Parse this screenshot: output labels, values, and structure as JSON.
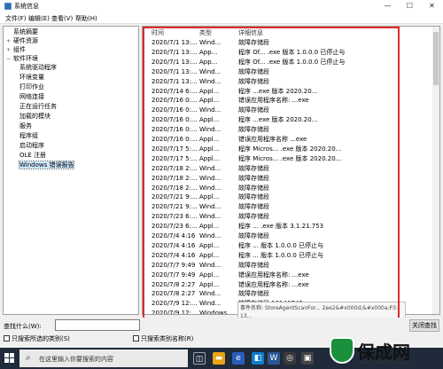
{
  "window": {
    "title": "系统信息",
    "buttons": [
      "—",
      "☐",
      "✕"
    ]
  },
  "menu": [
    "文件(F)",
    "编辑(E)",
    "查看(V)",
    "帮助(H)"
  ],
  "tree": [
    {
      "label": "系统摘要",
      "expander": ""
    },
    {
      "label": "硬件资源",
      "expander": "+"
    },
    {
      "label": "组件",
      "expander": "+"
    },
    {
      "label": "软件环境",
      "expander": "−"
    },
    {
      "label": "系统驱动程序",
      "expander": ""
    },
    {
      "label": "环境变量",
      "expander": ""
    },
    {
      "label": "打印作业",
      "expander": ""
    },
    {
      "label": "网络连接",
      "expander": ""
    },
    {
      "label": "正在运行任务",
      "expander": ""
    },
    {
      "label": "加载的模块",
      "expander": ""
    },
    {
      "label": "服务",
      "expander": ""
    },
    {
      "label": "程序组",
      "expander": ""
    },
    {
      "label": "启动程序",
      "expander": ""
    },
    {
      "label": "OLE 注册",
      "expander": ""
    },
    {
      "label": "Windows 错误报告",
      "expander": ""
    }
  ],
  "list": {
    "headers": [
      "时间",
      "类型",
      "详细信息"
    ],
    "rows": [
      {
        "time": "2020/7/1 13:...",
        "type": "Wind...",
        "detail": "故障存储段"
      },
      {
        "time": "2020/7/1 13:...",
        "type": "App...",
        "detail": "程序 Of... .exe 版本 1.0.0.0 已停止与"
      },
      {
        "time": "2020/7/1 13:...",
        "type": "App...",
        "detail": "程序 Of... .exe 版本 1.0.0.0 已停止与"
      },
      {
        "time": "2020/7/1 13:...",
        "type": "Wind...",
        "detail": "故障存储段"
      },
      {
        "time": "2020/7/1 13:...",
        "type": "Wind...",
        "detail": "故障存储段"
      },
      {
        "time": "2020/7/14 6:...",
        "type": "Appl...",
        "detail": "程序 ...exe 版本 2020.20..."
      },
      {
        "time": "2020/7/16 0:...",
        "type": "Appl...",
        "detail": "错误应用程序名称: ...exe"
      },
      {
        "time": "2020/7/16 0:...",
        "type": "Wind...",
        "detail": "故障存储段"
      },
      {
        "time": "2020/7/16 0:...",
        "type": "Appl...",
        "detail": "程序 ...exe 版本 2020.20..."
      },
      {
        "time": "2020/7/16 0:...",
        "type": "Wind...",
        "detail": "故障存储段"
      },
      {
        "time": "2020/7/16 0:...",
        "type": "Appl...",
        "detail": "错误应用程序名称 ...exe"
      },
      {
        "time": "2020/7/17 5:...",
        "type": "Appl...",
        "detail": "程序 Micros... .exe 版本 2020.20..."
      },
      {
        "time": "2020/7/17 5:...",
        "type": "Appl...",
        "detail": "程序 Micros... .exe 版本 2020.20..."
      },
      {
        "time": "2020/7/18 2:...",
        "type": "Wind...",
        "detail": "故障存储段"
      },
      {
        "time": "2020/7/18 2:...",
        "type": "Wind...",
        "detail": "故障存储段"
      },
      {
        "time": "2020/7/18 2:...",
        "type": "Wind...",
        "detail": "故障存储段"
      },
      {
        "time": "2020/7/21 9:...",
        "type": "Appl...",
        "detail": "故障存储段"
      },
      {
        "time": "2020/7/21 9:...",
        "type": "Wind...",
        "detail": "故障存储段"
      },
      {
        "time": "2020/7/23 6:...",
        "type": "Wind...",
        "detail": "故障存储段"
      },
      {
        "time": "2020/7/23 6:...",
        "type": "Appl...",
        "detail": "程序 ... .exe 版本 3.1.21.753"
      },
      {
        "time": "2020/7/4 4:16",
        "type": "Wind...",
        "detail": "故障存储段"
      },
      {
        "time": "2020/7/4 4:16",
        "type": "Appl...",
        "detail": "程序 ... 版本 1.0.0.0 已停止与"
      },
      {
        "time": "2020/7/4 4:16",
        "type": "Appl...",
        "detail": "程序 ... 版本 1.0.0.0 已停止与"
      },
      {
        "time": "2020/7/7 9:49",
        "type": "Wind...",
        "detail": "故障存储段"
      },
      {
        "time": "2020/7/7 9:49",
        "type": "Appl...",
        "detail": "错误应用程序名称: ...exe"
      },
      {
        "time": "2020/7/8 2:27",
        "type": "Appl...",
        "detail": "错误应用程序名称: ...exe"
      },
      {
        "time": "2020/7/8 2:27",
        "type": "Wind...",
        "detail": "故障存储段"
      },
      {
        "time": "2020/7/9 12:...",
        "type": "Wind...",
        "detail": "故障存储段 16146742..."
      },
      {
        "time": "2020/7/9 12:...",
        "type": "Windows...",
        "detail": "故障存储段"
      }
    ],
    "tooltip": "事件名称: StoreAgentScanFor... 2ee2&#x000d;&#x000a;P3: 13..."
  },
  "find": {
    "label": "查找什么(W):",
    "value": "",
    "checkbox_selected": "只搜索所选的类别(S)",
    "checkbox_names": "只搜索类别名称(R)",
    "close_label": "关闭查找"
  },
  "taskbar": {
    "search_placeholder": "在这里输入你要搜索的内容"
  },
  "watermark": {
    "brand": "保成网",
    "url": "www.zsbaochen.net"
  }
}
